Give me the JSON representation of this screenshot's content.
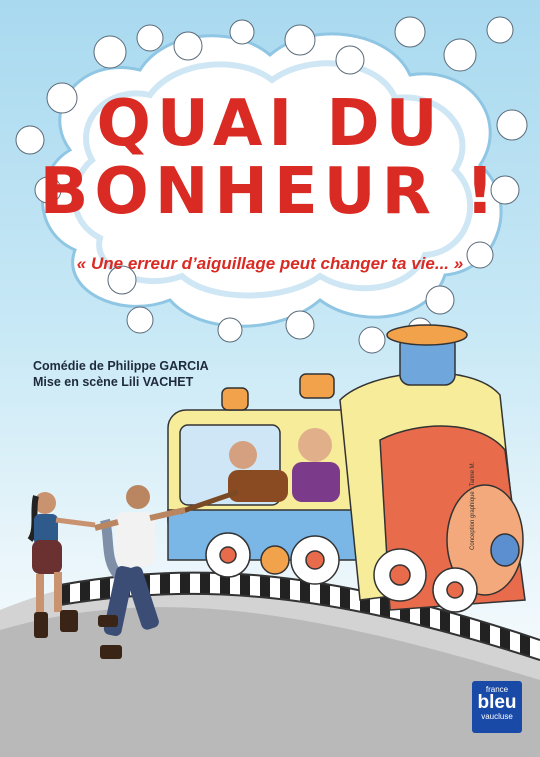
{
  "poster": {
    "title_line1": "QUAI DU",
    "title_line2": "BONHEUR !",
    "tagline": "« Une erreur d’aiguillage peut changer ta vie... »",
    "credit_author": "Comédie de Philippe GARCIA",
    "credit_director": "Mise en scène Lili VACHET",
    "graphic_credit": "Conception graphique : Tanne M.",
    "title_color": "#d92a23"
  },
  "logo": {
    "line1": "france",
    "line2": "bleu",
    "line3": "vaucluse",
    "color": "#1a4aa8"
  }
}
